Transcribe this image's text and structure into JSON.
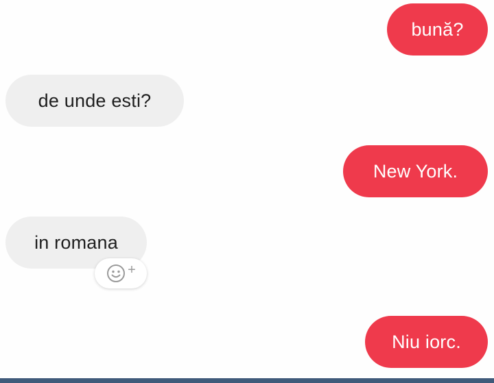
{
  "conversation": {
    "messages": [
      {
        "direction": "outgoing",
        "text": "bună?"
      },
      {
        "direction": "incoming",
        "text": "de unde esti?"
      },
      {
        "direction": "outgoing",
        "text": "New York."
      },
      {
        "direction": "incoming",
        "text": "in romana"
      },
      {
        "direction": "outgoing",
        "text": "Niu iorc."
      }
    ],
    "reaction_button": {
      "icon": "smiley-add-icon",
      "plus": "+"
    }
  },
  "colors": {
    "outgoing_bubble": "#ef3a4c",
    "incoming_bubble": "#efefef",
    "outgoing_text": "#ffffff",
    "incoming_text": "#1e1e1e",
    "bottom_bar": "#3f5a7a"
  }
}
